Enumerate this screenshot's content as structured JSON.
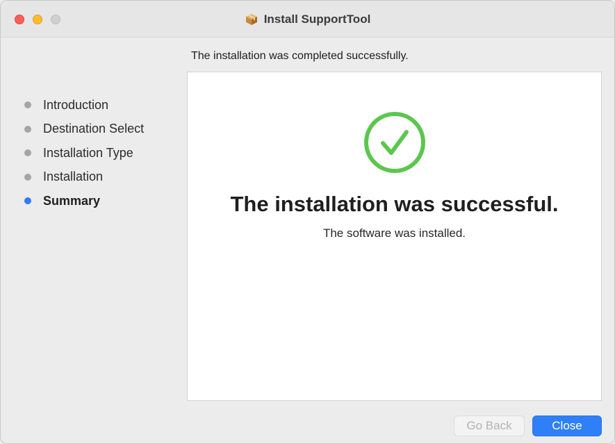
{
  "window": {
    "title": "Install SupportTool",
    "title_icon": "package-icon"
  },
  "header": {
    "message": "The installation was completed successfully."
  },
  "steps": [
    {
      "label": "Introduction",
      "active": false
    },
    {
      "label": "Destination Select",
      "active": false
    },
    {
      "label": "Installation Type",
      "active": false
    },
    {
      "label": "Installation",
      "active": false
    },
    {
      "label": "Summary",
      "active": true
    }
  ],
  "content": {
    "icon": "checkmark-circle-icon",
    "title": "The installation was successful.",
    "subtitle": "The software was installed."
  },
  "buttons": {
    "back_label": "Go Back",
    "close_label": "Close"
  },
  "colors": {
    "accent": "#2f80f7",
    "success": "#5cc64f",
    "close_traffic": "#ff5f57",
    "minimize_traffic": "#febc2e",
    "zoom_traffic": "#d0d0d0"
  }
}
